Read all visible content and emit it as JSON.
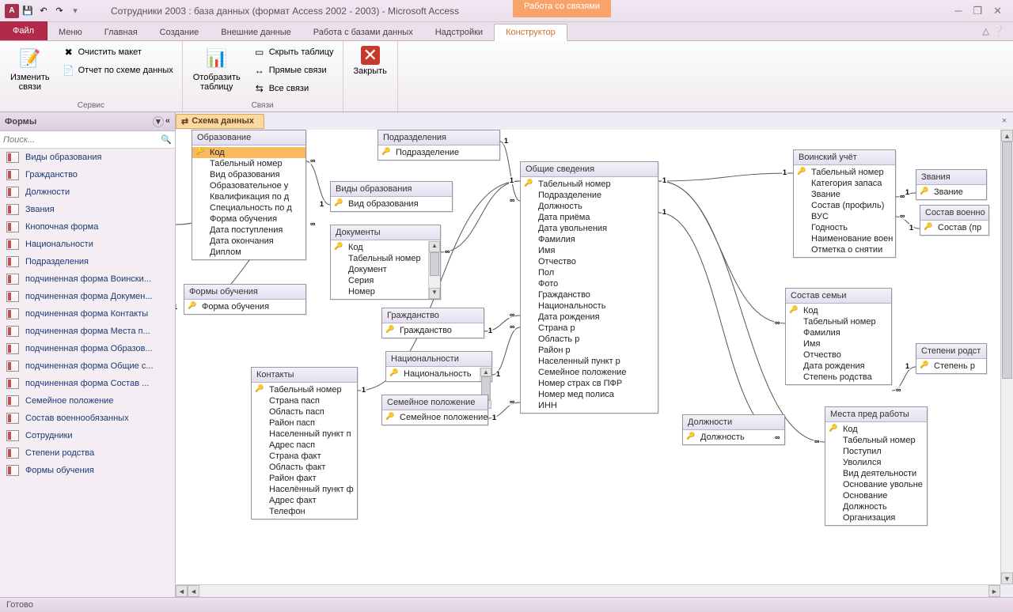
{
  "title": "Сотрудники 2003 : база данных (формат Access 2002 - 2003)  -  Microsoft Access",
  "contextTabGroup": "Работа со связями",
  "tabs": {
    "file": "Файл",
    "menu": "Меню",
    "home": "Главная",
    "create": "Создание",
    "external": "Внешние данные",
    "dbtools": "Работа с базами данных",
    "addins": "Надстройки",
    "designer": "Конструктор"
  },
  "ribbon": {
    "editRel": "Изменить\nсвязи",
    "clear": "Очистить макет",
    "report": "Отчет по схеме данных",
    "groupService": "Сервис",
    "showTable": "Отобразить\nтаблицу",
    "hideTable": "Скрыть таблицу",
    "direct": "Прямые связи",
    "all": "Все связи",
    "groupLinks": "Связи",
    "close": "Закрыть"
  },
  "nav": {
    "header": "Формы",
    "searchPlaceholder": "Поиск...",
    "items": [
      "Виды образования",
      "Гражданство",
      "Должности",
      "Звания",
      "Кнопочная форма",
      "Национальности",
      "Подразделения",
      "подчиненная форма Воински...",
      "подчиненная форма Докумен...",
      "подчиненная форма Контакты",
      "подчиненная форма Места п...",
      "подчиненная форма Образов...",
      "подчиненная форма Общие с...",
      "подчиненная форма Состав ...",
      "Семейное положение",
      "Состав военнообязанных",
      "Сотрудники",
      "Степени родства",
      "Формы обучения"
    ]
  },
  "docTab": "Схема данных",
  "tables": {
    "education": {
      "title": "Образование",
      "fields": [
        {
          "n": "Код",
          "pk": true,
          "sel": true
        },
        {
          "n": "Табельный номер"
        },
        {
          "n": "Вид образования"
        },
        {
          "n": "Образовательное у"
        },
        {
          "n": "Квалификация по д"
        },
        {
          "n": "Специальность по д"
        },
        {
          "n": "Форма обучения"
        },
        {
          "n": "Дата поступления"
        },
        {
          "n": "Дата окончания"
        },
        {
          "n": "Диплом"
        }
      ]
    },
    "eduForms": {
      "title": "Формы обучения",
      "fields": [
        {
          "n": "Форма обучения",
          "pk": true
        }
      ]
    },
    "eduKinds": {
      "title": "Виды образования",
      "fields": [
        {
          "n": "Вид образования",
          "pk": true
        }
      ]
    },
    "docs": {
      "title": "Документы",
      "fields": [
        {
          "n": "Код",
          "pk": true
        },
        {
          "n": "Табельный номер"
        },
        {
          "n": "Документ"
        },
        {
          "n": "Серия"
        },
        {
          "n": "Номер"
        }
      ]
    },
    "subdiv": {
      "title": "Подразделения",
      "fields": [
        {
          "n": "Подразделение",
          "pk": true
        }
      ]
    },
    "general": {
      "title": "Общие сведения",
      "fields": [
        {
          "n": "Табельный номер",
          "pk": true
        },
        {
          "n": "Подразделение"
        },
        {
          "n": "Должность"
        },
        {
          "n": "Дата приёма"
        },
        {
          "n": "Дата увольнения"
        },
        {
          "n": "Фамилия"
        },
        {
          "n": "Имя"
        },
        {
          "n": "Отчество"
        },
        {
          "n": "Пол"
        },
        {
          "n": "Фото"
        },
        {
          "n": "Гражданство"
        },
        {
          "n": "Национальность"
        },
        {
          "n": "Дата рождения"
        },
        {
          "n": "Страна р"
        },
        {
          "n": "Область р"
        },
        {
          "n": "Район р"
        },
        {
          "n": "Населенный пункт р"
        },
        {
          "n": "Семейное положение"
        },
        {
          "n": "Номер страх св ПФР"
        },
        {
          "n": "Номер мед полиса"
        },
        {
          "n": "ИНН"
        }
      ]
    },
    "citizenship": {
      "title": "Гражданство",
      "fields": [
        {
          "n": "Гражданство",
          "pk": true
        }
      ]
    },
    "nationality": {
      "title": "Национальности",
      "fields": [
        {
          "n": "Национальность",
          "pk": true
        }
      ]
    },
    "marital": {
      "title": "Семейное положение",
      "fields": [
        {
          "n": "Семейное положение",
          "pk": true
        }
      ]
    },
    "positions": {
      "title": "Должности",
      "fields": [
        {
          "n": "Должность",
          "pk": true
        }
      ]
    },
    "contacts": {
      "title": "Контакты",
      "fields": [
        {
          "n": "Табельный номер",
          "pk": true
        },
        {
          "n": "Страна пасп"
        },
        {
          "n": "Область пасп"
        },
        {
          "n": "Район пасп"
        },
        {
          "n": "Населенный пункт п"
        },
        {
          "n": "Адрес пасп"
        },
        {
          "n": "Страна факт"
        },
        {
          "n": "Область факт"
        },
        {
          "n": "Район факт"
        },
        {
          "n": "Населённый пункт ф"
        },
        {
          "n": "Адрес факт"
        },
        {
          "n": "Телефон"
        }
      ]
    },
    "military": {
      "title": "Воинский учёт",
      "fields": [
        {
          "n": "Табельный номер",
          "pk": true
        },
        {
          "n": "Категория запаса"
        },
        {
          "n": "Звание"
        },
        {
          "n": "Состав (профиль)"
        },
        {
          "n": "ВУС"
        },
        {
          "n": "Годность"
        },
        {
          "n": "Наименование воен"
        },
        {
          "n": "Отметка о снятии"
        }
      ]
    },
    "ranks": {
      "title": "Звания",
      "fields": [
        {
          "n": "Звание",
          "pk": true
        }
      ]
    },
    "milComp": {
      "title": "Состав военно",
      "fields": [
        {
          "n": "Состав (пр",
          "pk": true
        }
      ]
    },
    "family": {
      "title": "Состав семьи",
      "fields": [
        {
          "n": "Код",
          "pk": true
        },
        {
          "n": "Табельный номер"
        },
        {
          "n": "Фамилия"
        },
        {
          "n": "Имя"
        },
        {
          "n": "Отчество"
        },
        {
          "n": "Дата рождения"
        },
        {
          "n": "Степень родства"
        }
      ]
    },
    "kinship": {
      "title": "Степени родст",
      "fields": [
        {
          "n": "Степень р",
          "pk": true
        }
      ]
    },
    "prevWork": {
      "title": "Места пред работы",
      "fields": [
        {
          "n": "Код",
          "pk": true
        },
        {
          "n": "Табельный номер"
        },
        {
          "n": "Поступил"
        },
        {
          "n": "Уволился"
        },
        {
          "n": "Вид деятельности"
        },
        {
          "n": "Основание увольне"
        },
        {
          "n": "Основание"
        },
        {
          "n": "Должность"
        },
        {
          "n": "Организация"
        }
      ]
    }
  },
  "status": "Готово"
}
